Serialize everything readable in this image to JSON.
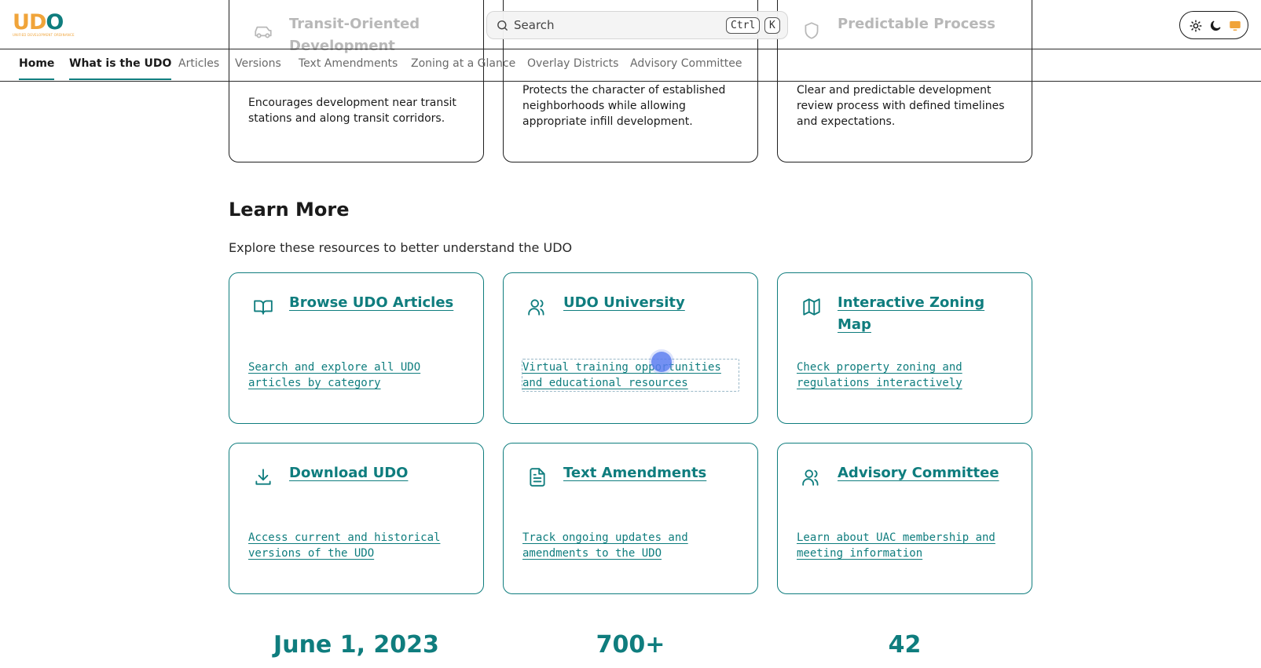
{
  "header": {
    "logo_text": "UDO",
    "logo_tagline": "UNIFIED DEVELOPMENT ORDINANCE",
    "search": {
      "label": "Search",
      "shortcut_ctrl": "Ctrl",
      "shortcut_key": "K"
    },
    "theme_options": [
      "sun-icon",
      "moon-icon",
      "monitor-icon"
    ],
    "theme_selected": "system"
  },
  "nav": {
    "items": [
      {
        "label": "Home",
        "active": true
      },
      {
        "label": "What is the UDO",
        "active": true
      },
      {
        "label": "Articles",
        "active": false
      },
      {
        "label": "Versions",
        "active": false
      },
      {
        "label": "Text Amendments",
        "active": false
      },
      {
        "label": "Zoning at a Glance",
        "active": false
      },
      {
        "label": "Overlay Districts",
        "active": false
      },
      {
        "label": "Advisory Committee",
        "active": false
      }
    ]
  },
  "features": [
    {
      "title": "Transit-Oriented Development",
      "icon": "car-icon",
      "description": "Encourages development near transit stations and along transit corridors."
    },
    {
      "title": "",
      "icon": "",
      "description": "Protects the character of established neighborhoods while allowing appropriate infill development."
    },
    {
      "title": "Predictable Process",
      "icon": "shield-icon",
      "description": "Clear and predictable development review process with defined timelines and expectations."
    }
  ],
  "learn_more": {
    "title": "Learn More",
    "subtitle": "Explore these resources to better understand the UDO",
    "cards": [
      {
        "title": "Browse UDO Articles",
        "icon": "book-icon",
        "description": "Search and explore all UDO articles by category"
      },
      {
        "title": "UDO University",
        "icon": "users-icon",
        "description": "Virtual training opportunities and educational resources"
      },
      {
        "title": "Interactive Zoning Map",
        "icon": "map-icon",
        "description": "Check property zoning and regulations interactively"
      },
      {
        "title": "Download UDO",
        "icon": "download-icon",
        "description": "Access current and historical versions of the UDO"
      },
      {
        "title": "Text Amendments",
        "icon": "file-text-icon",
        "description": "Track ongoing updates and amendments to the UDO"
      },
      {
        "title": "Advisory Committee",
        "icon": "users-icon",
        "description": "Learn about UAC membership and meeting information"
      }
    ]
  },
  "stats": [
    "June 1, 2023",
    "700+",
    "42"
  ],
  "colors": {
    "accent": "#0f7d7e",
    "logo_orange": "#f0a43a",
    "muted": "#b8b8b8",
    "cursor": "#5b7df0"
  }
}
